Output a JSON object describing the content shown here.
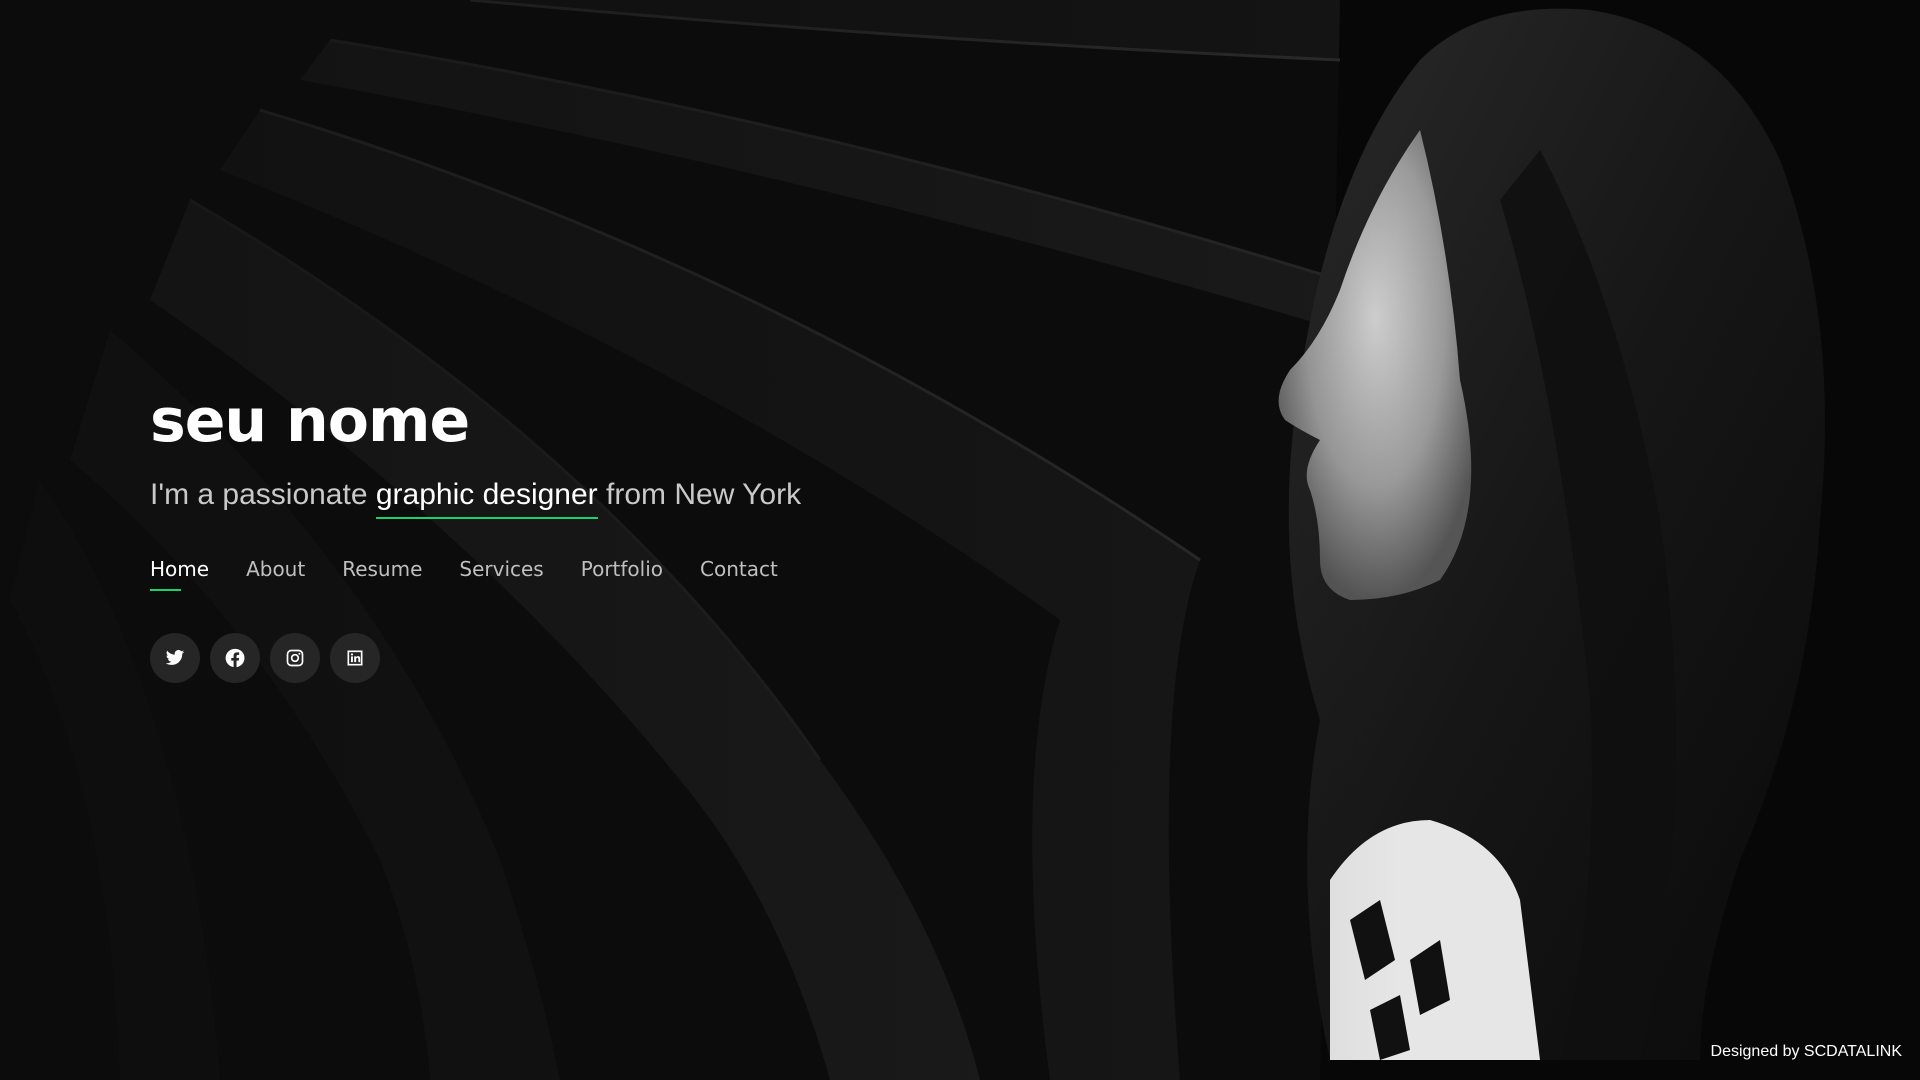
{
  "hero": {
    "name": "seu nome",
    "tagline_prefix": "I'm a passionate ",
    "tagline_typed": "graphic designer",
    "tagline_suffix": " from New York"
  },
  "nav": {
    "items": [
      {
        "label": "Home",
        "active": true
      },
      {
        "label": "About"
      },
      {
        "label": "Resume"
      },
      {
        "label": "Services"
      },
      {
        "label": "Portfolio"
      },
      {
        "label": "Contact"
      }
    ]
  },
  "social": {
    "icons": [
      "twitter-icon",
      "facebook-icon",
      "instagram-icon",
      "linkedin-icon"
    ]
  },
  "credits": {
    "prefix": "Designed by ",
    "author": "SCDATALINK"
  },
  "colors": {
    "accent": "#18d26e",
    "background": "#0c0c0c",
    "social_button": "#262626"
  }
}
